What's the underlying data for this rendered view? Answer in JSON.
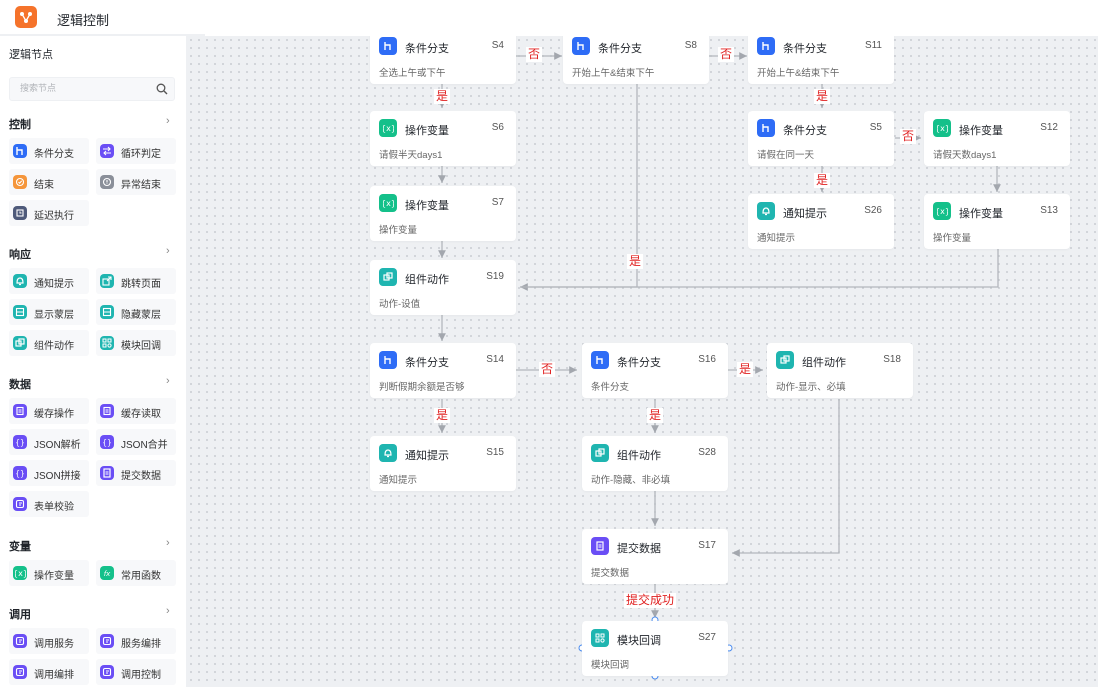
{
  "app": {
    "title": "逻辑控制"
  },
  "sidebar": {
    "title": "逻辑节点",
    "search_placeholder": "搜索节点",
    "categories": [
      {
        "name": "控制",
        "items": [
          "条件分支",
          "循环判定",
          "结束",
          "异常结束",
          "延迟执行"
        ]
      },
      {
        "name": "响应",
        "items": [
          "通知提示",
          "跳转页面",
          "显示蒙层",
          "隐藏蒙层",
          "组件动作",
          "模块回调"
        ]
      },
      {
        "name": "数据",
        "items": [
          "缓存操作",
          "缓存读取",
          "JSON解析",
          "JSON合并",
          "JSON拼接",
          "提交数据",
          "表单校验"
        ]
      },
      {
        "name": "变量",
        "items": [
          "操作变量",
          "常用函数"
        ]
      },
      {
        "name": "调用",
        "items": [
          "调用服务",
          "服务编排",
          "调用编排",
          "调用控制"
        ]
      }
    ]
  },
  "nodes": {
    "S4": {
      "title": "条件分支",
      "id": "S4",
      "sub": "全选上午或下午"
    },
    "S8": {
      "title": "条件分支",
      "id": "S8",
      "sub": "开始上午&结束下午"
    },
    "S11": {
      "title": "条件分支",
      "id": "S11",
      "sub": "开始上午&结束下午"
    },
    "S6": {
      "title": "操作变量",
      "id": "S6",
      "sub": "请假半天days1"
    },
    "S5": {
      "title": "条件分支",
      "id": "S5",
      "sub": "请假在同一天"
    },
    "S12": {
      "title": "操作变量",
      "id": "S12",
      "sub": "请假天数days1"
    },
    "S7": {
      "title": "操作变量",
      "id": "S7",
      "sub": "操作变量"
    },
    "S26": {
      "title": "通知提示",
      "id": "S26",
      "sub": "通知提示"
    },
    "S13": {
      "title": "操作变量",
      "id": "S13",
      "sub": "操作变量"
    },
    "S19": {
      "title": "组件动作",
      "id": "S19",
      "sub": "动作-设值"
    },
    "S14": {
      "title": "条件分支",
      "id": "S14",
      "sub": "判断假期余额是否够"
    },
    "S16": {
      "title": "条件分支",
      "id": "S16",
      "sub": "条件分支"
    },
    "S18": {
      "title": "组件动作",
      "id": "S18",
      "sub": "动作-显示、必填"
    },
    "S15": {
      "title": "通知提示",
      "id": "S15",
      "sub": "通知提示"
    },
    "S28": {
      "title": "组件动作",
      "id": "S28",
      "sub": "动作-隐藏、非必填"
    },
    "S17": {
      "title": "提交数据",
      "id": "S17",
      "sub": "提交数据"
    },
    "S27": {
      "title": "模块回调",
      "id": "S27",
      "sub": "模块回调"
    }
  },
  "edge_labels": {
    "yes": "是",
    "no": "否",
    "submit_success": "提交成功"
  },
  "colors": {
    "blue": "#2e6cf6",
    "green": "#14c08a",
    "teal": "#1fb5b0",
    "purple": "#6a4ef5",
    "orange": "#f5963b",
    "gray": "#8a8f99",
    "navy": "#4e5a7a",
    "accent": "#f5732b",
    "label_red": "#e02020"
  }
}
